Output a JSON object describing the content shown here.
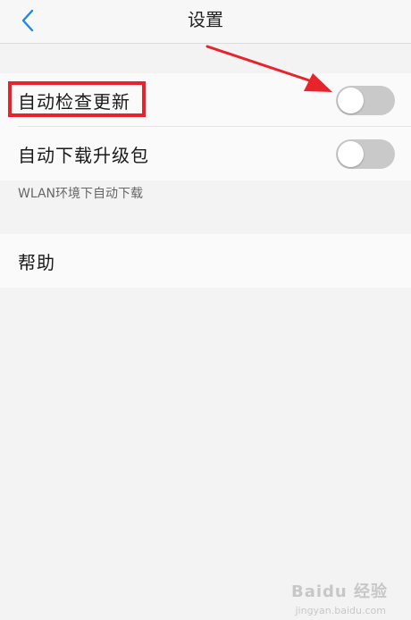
{
  "nav": {
    "title": "设置",
    "back_icon": "chevron-left-icon"
  },
  "settings": {
    "auto_check_label": "自动检查更新",
    "auto_check_on": false,
    "auto_download_label": "自动下载升级包",
    "auto_download_on": false,
    "wlan_hint": "WLAN环境下自动下载",
    "help_label": "帮助"
  },
  "annotation": {
    "highlight_color": "#e8232c"
  },
  "watermark": {
    "text": "Baidu 经验",
    "sub": "jingyan.baidu.com"
  },
  "colors": {
    "accent": "#1e88e5",
    "toggle_off": "#c9c9c9",
    "background": "#f3f3f3"
  }
}
